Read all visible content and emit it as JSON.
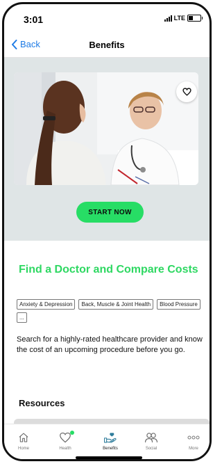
{
  "status": {
    "time": "3:01",
    "network": "LTE"
  },
  "nav": {
    "back_label": "Back",
    "title": "Benefits"
  },
  "hero": {
    "cta_label": "START NOW"
  },
  "content": {
    "heading": "Find a Doctor and Compare Costs",
    "tags": [
      "Anxiety & Depression",
      "Back, Muscle & Joint Health",
      "Blood Pressure",
      "..."
    ],
    "description": "Search for a highly-rated healthcare provider and know the cost of an upcoming procedure before you go.",
    "resources_title": "Resources"
  },
  "tabs": [
    {
      "label": "Home",
      "icon": "home-icon"
    },
    {
      "label": "Health",
      "icon": "heart-icon",
      "badge": true
    },
    {
      "label": "Benefits",
      "icon": "benefits-hand-icon",
      "active": true
    },
    {
      "label": "Social",
      "icon": "people-icon"
    },
    {
      "label": "More",
      "icon": "more-dots-icon"
    }
  ],
  "colors": {
    "accent_green": "#27dd65",
    "heading_green": "#2ed862",
    "link_blue": "#1e7be5",
    "hero_bg": "#dfe5e6"
  }
}
